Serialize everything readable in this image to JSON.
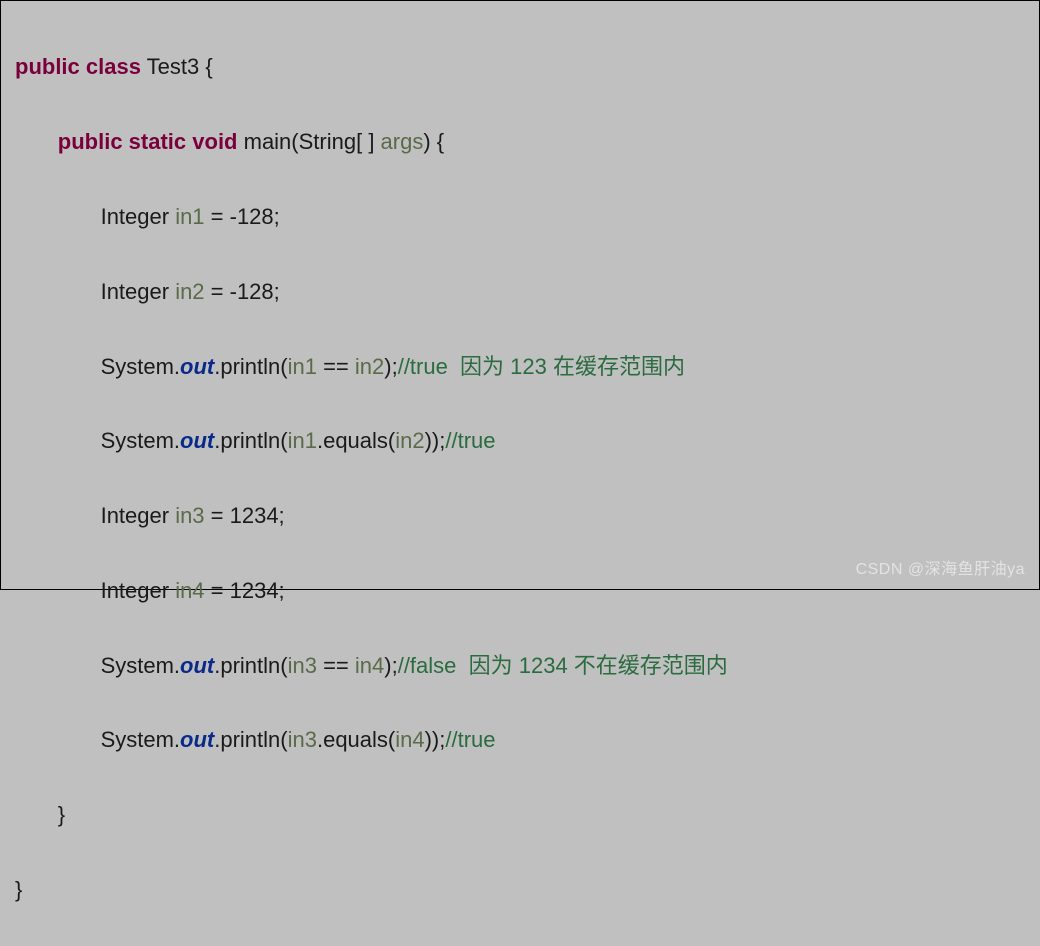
{
  "code": {
    "line1": {
      "kw1": "public class",
      "name": " Test3 {"
    },
    "line2": {
      "indent": "       ",
      "kw1": "public static void",
      "name": " main(String[ ] ",
      "arg": "args",
      "close": ") {"
    },
    "line3": {
      "indent": "              ",
      "type": "Integer ",
      "var": "in1",
      "rest": " = -128;"
    },
    "line4": {
      "indent": "              ",
      "type": "Integer ",
      "var": "in2",
      "rest": " = -128;"
    },
    "line5": {
      "indent": "              ",
      "sys": "System.",
      "out": "out",
      "mid1": ".println(",
      "v1": "in1",
      "eq": " == ",
      "v2": "in2",
      "close": ");",
      "comment": "//true  因为 123 在缓存范围内"
    },
    "line6": {
      "indent": "              ",
      "sys": "System.",
      "out": "out",
      "mid1": ".println(",
      "v1": "in1",
      "mid2": ".equals(",
      "v2": "in2",
      "close": "));",
      "comment": "//true"
    },
    "line7": {
      "indent": "              ",
      "type": "Integer ",
      "var": "in3",
      "rest": " = 1234;"
    },
    "line8": {
      "indent": "              ",
      "type": "Integer ",
      "var": "in4",
      "rest": " = 1234;"
    },
    "line9": {
      "indent": "              ",
      "sys": "System.",
      "out": "out",
      "mid1": ".println(",
      "v1": "in3",
      "eq": " == ",
      "v2": "in4",
      "close": ");",
      "comment": "//false  因为 1234 不在缓存范围内"
    },
    "line10": {
      "indent": "              ",
      "sys": "System.",
      "out": "out",
      "mid1": ".println(",
      "v1": "in3",
      "mid2": ".equals(",
      "v2": "in4",
      "close": "));",
      "comment": "//true"
    },
    "line11": {
      "indent": "       ",
      "brace": "}"
    },
    "line12": {
      "brace": "}"
    }
  },
  "watermark": "CSDN @深海鱼肝油ya"
}
